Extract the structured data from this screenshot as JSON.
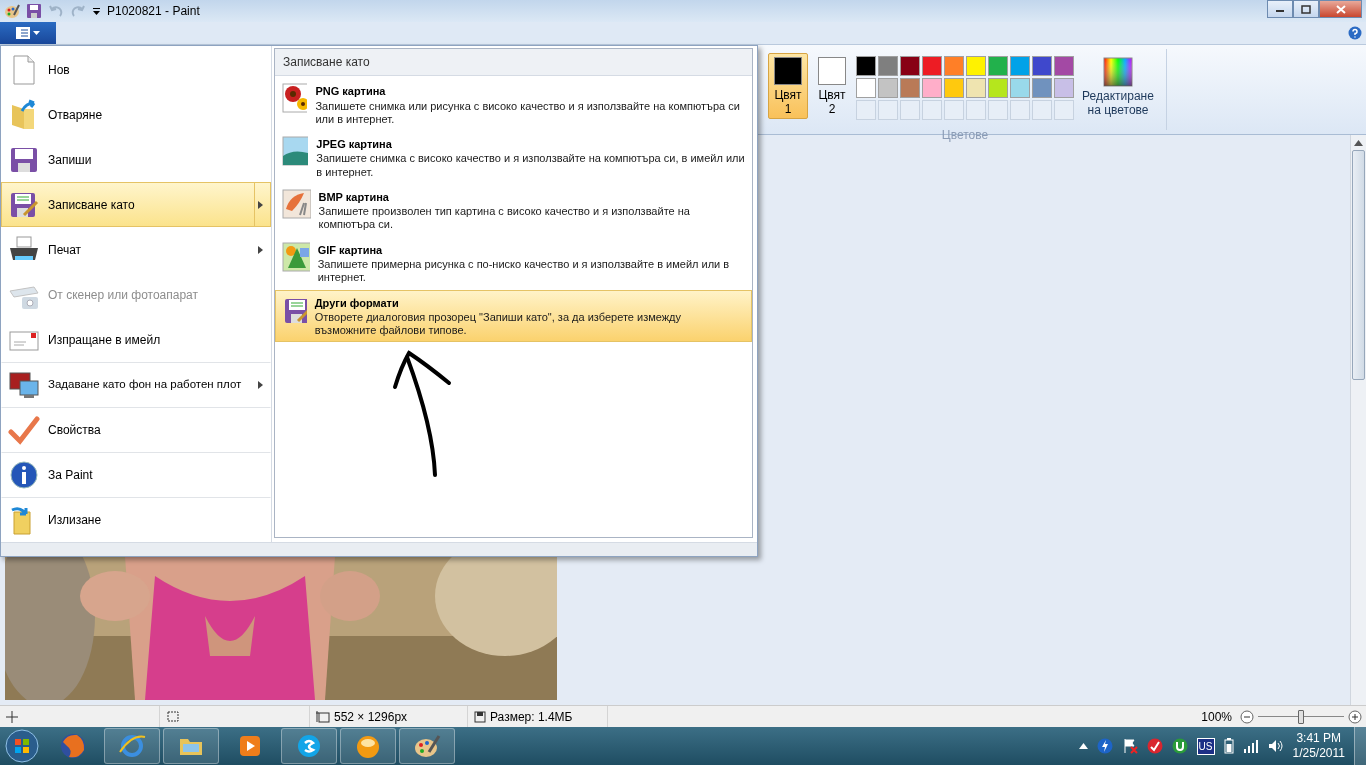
{
  "title_bar": {
    "title": "P1020821 - Paint"
  },
  "file_menu": {
    "items": [
      {
        "label": "Нов",
        "selected": false,
        "disabled": false,
        "submenu": false,
        "group_start": false
      },
      {
        "label": "Отваряне",
        "selected": false,
        "disabled": false,
        "submenu": false,
        "group_start": false
      },
      {
        "label": "Запиши",
        "selected": false,
        "disabled": false,
        "submenu": false,
        "group_start": false
      },
      {
        "label": "Записване като",
        "selected": true,
        "disabled": false,
        "submenu": true,
        "group_start": false
      },
      {
        "label": "Печат",
        "selected": false,
        "disabled": false,
        "submenu": true,
        "group_start": false
      },
      {
        "label": "От скенер или фотоапарат",
        "selected": false,
        "disabled": true,
        "submenu": false,
        "group_start": false
      },
      {
        "label": "Изпращане в имейл",
        "selected": false,
        "disabled": false,
        "submenu": false,
        "group_start": false
      },
      {
        "label": "Задаване като фон на работен плот",
        "selected": false,
        "disabled": false,
        "submenu": true,
        "group_start": true
      },
      {
        "label": "Свойства",
        "selected": false,
        "disabled": false,
        "submenu": false,
        "group_start": true
      },
      {
        "label": "За Paint",
        "selected": false,
        "disabled": false,
        "submenu": false,
        "group_start": true
      },
      {
        "label": "Излизане",
        "selected": false,
        "disabled": false,
        "submenu": false,
        "group_start": true
      }
    ]
  },
  "save_as_submenu": {
    "title": "Записване като",
    "items": [
      {
        "label": "PNG картина",
        "description": "Запишете снимка или рисунка с високо качество и я използвайте на компютъра си или в интернет.",
        "selected": false
      },
      {
        "label": "JPEG картина",
        "description": "Запишете снимка с високо качество и я използвайте на компютъра си, в имейл или в интернет.",
        "selected": false
      },
      {
        "label": "BMP картина",
        "description": "Запишете произволен тип картина с високо качество и я използвайте на компютъра си.",
        "selected": false
      },
      {
        "label": "GIF картина",
        "description": "Запишете примерна рисунка с по-ниско качество и я използвайте в имейл или в интернет.",
        "selected": false
      },
      {
        "label": "Други формати",
        "description": "Отворете диалоговия прозорец \"Запиши като\", за да изберете измежду възможните файлови типове.",
        "selected": true
      }
    ]
  },
  "colors_group": {
    "label": "Цветове",
    "current": [
      {
        "label": "Цвят 1",
        "color": "#000000",
        "selected": true
      },
      {
        "label": "Цвят 2",
        "color": "#ffffff",
        "selected": false
      }
    ],
    "palette": [
      {
        "color": "#000000"
      },
      {
        "color": "#7f7f7f"
      },
      {
        "color": "#880015"
      },
      {
        "color": "#ed1c24"
      },
      {
        "color": "#ff7f27"
      },
      {
        "color": "#fff200"
      },
      {
        "color": "#22b14c"
      },
      {
        "color": "#00a2e8"
      },
      {
        "color": "#3f48cc"
      },
      {
        "color": "#a349a4"
      },
      {
        "color": "#ffffff"
      },
      {
        "color": "#c3c3c3"
      },
      {
        "color": "#b97a57"
      },
      {
        "color": "#ffaec9"
      },
      {
        "color": "#ffc90e"
      },
      {
        "color": "#efe4b0"
      },
      {
        "color": "#b5e61d"
      },
      {
        "color": "#99d9ea"
      },
      {
        "color": "#7092be"
      },
      {
        "color": "#c8bfe7"
      }
    ],
    "edit_colors": "Редактиране на цветове"
  },
  "status_bar": {
    "dimensions": "552 × 1296px",
    "size": "Размер: 1.4МБ",
    "zoom": "100%",
    "zoom_slider": {
      "level": 0.5
    }
  },
  "taskbar": {
    "language": "US",
    "time": "3:41 PM",
    "date": "1/25/2011"
  }
}
